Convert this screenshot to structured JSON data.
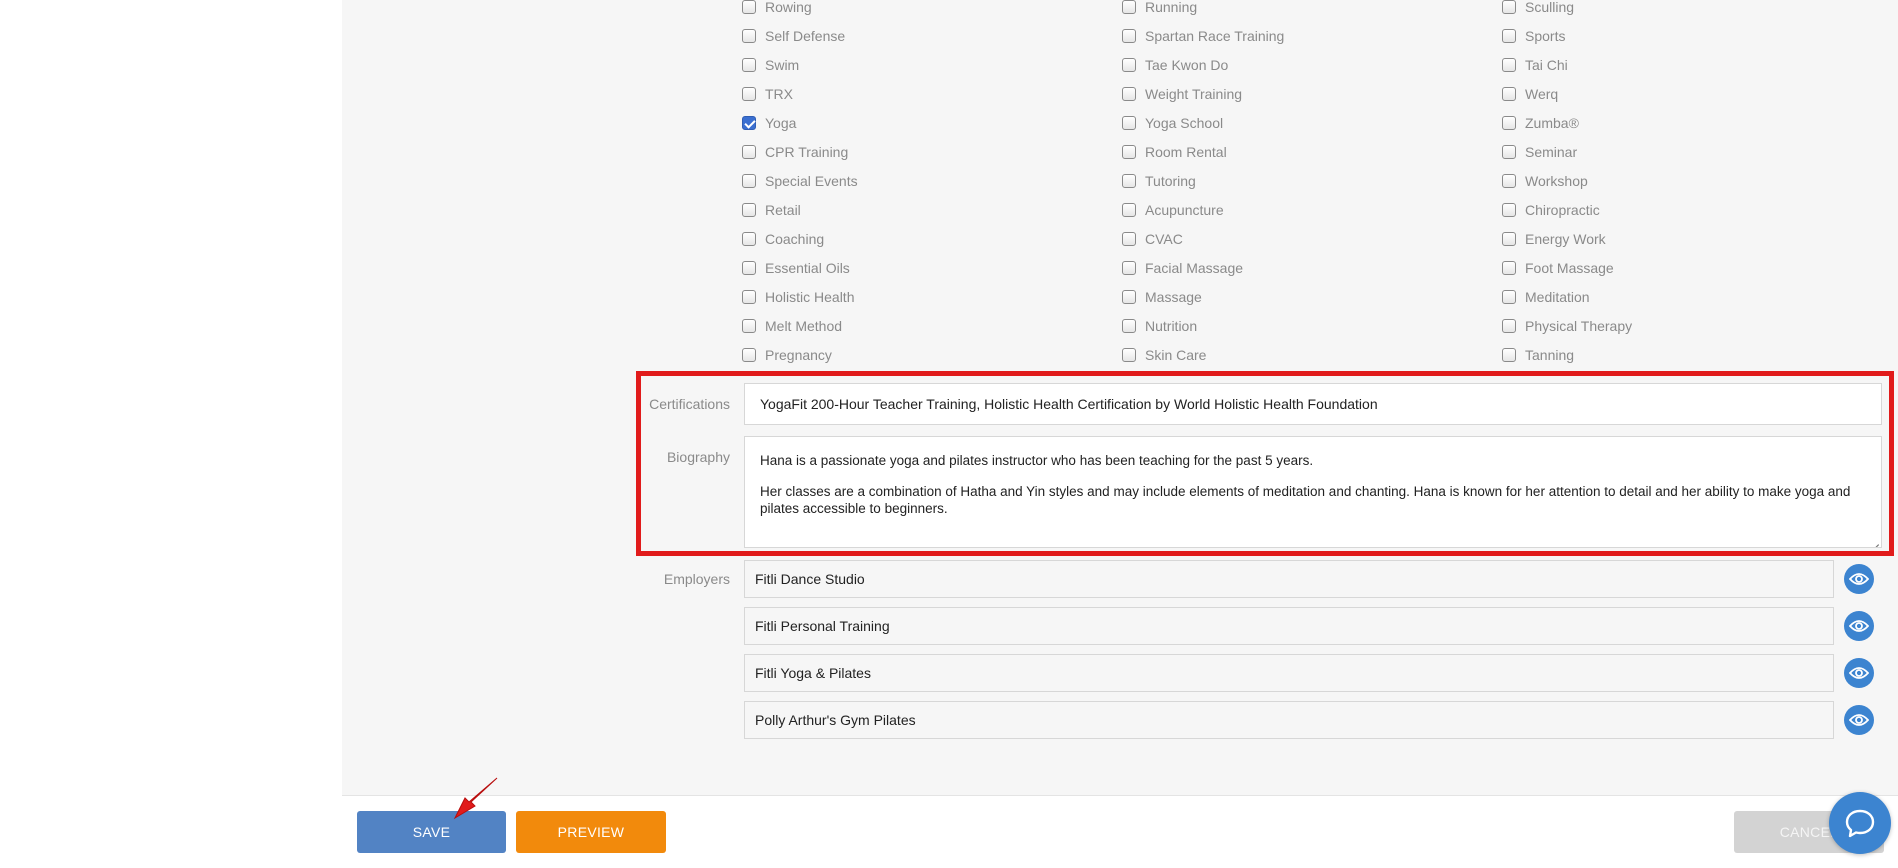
{
  "activities": {
    "columns": [
      [
        {
          "label": "Rowing",
          "checked": false
        },
        {
          "label": "Self Defense",
          "checked": false
        },
        {
          "label": "Swim",
          "checked": false
        },
        {
          "label": "TRX",
          "checked": false
        },
        {
          "label": "Yoga",
          "checked": true
        },
        {
          "label": "CPR Training",
          "checked": false
        },
        {
          "label": "Special Events",
          "checked": false
        },
        {
          "label": "Retail",
          "checked": false
        },
        {
          "label": "Coaching",
          "checked": false
        },
        {
          "label": "Essential Oils",
          "checked": false
        },
        {
          "label": "Holistic Health",
          "checked": false
        },
        {
          "label": "Melt Method",
          "checked": false
        },
        {
          "label": "Pregnancy",
          "checked": false
        }
      ],
      [
        {
          "label": "Running",
          "checked": false
        },
        {
          "label": "Spartan Race Training",
          "checked": false
        },
        {
          "label": "Tae Kwon Do",
          "checked": false
        },
        {
          "label": "Weight Training",
          "checked": false
        },
        {
          "label": "Yoga School",
          "checked": false
        },
        {
          "label": "Room Rental",
          "checked": false
        },
        {
          "label": "Tutoring",
          "checked": false
        },
        {
          "label": "Acupuncture",
          "checked": false
        },
        {
          "label": "CVAC",
          "checked": false
        },
        {
          "label": "Facial Massage",
          "checked": false
        },
        {
          "label": "Massage",
          "checked": false
        },
        {
          "label": "Nutrition",
          "checked": false
        },
        {
          "label": "Skin Care",
          "checked": false
        }
      ],
      [
        {
          "label": "Sculling",
          "checked": false
        },
        {
          "label": "Sports",
          "checked": false
        },
        {
          "label": "Tai Chi",
          "checked": false
        },
        {
          "label": "Werq",
          "checked": false
        },
        {
          "label": "Zumba®",
          "checked": false
        },
        {
          "label": "Seminar",
          "checked": false
        },
        {
          "label": "Workshop",
          "checked": false
        },
        {
          "label": "Chiropractic",
          "checked": false
        },
        {
          "label": "Energy Work",
          "checked": false
        },
        {
          "label": "Foot Massage",
          "checked": false
        },
        {
          "label": "Meditation",
          "checked": false
        },
        {
          "label": "Physical Therapy",
          "checked": false
        },
        {
          "label": "Tanning",
          "checked": false
        }
      ]
    ]
  },
  "form": {
    "certifications_label": "Certifications",
    "certifications_value": "YogaFit 200-Hour Teacher Training, Holistic Health Certification by World Holistic Health Foundation",
    "biography_label": "Biography",
    "biography_p1": "Hana is a passionate yoga and pilates instructor who has been teaching for the past 5 years.",
    "biography_p2": "Her classes are a combination of Hatha and Yin styles and may include elements of meditation and chanting. Hana is known for her attention to detail and her ability to make yoga and pilates accessible to beginners.",
    "employers_label": "Employers",
    "employers": [
      "Fitli Dance Studio",
      "Fitli Personal Training",
      "Fitli Yoga & Pilates",
      "Polly Arthur's Gym Pilates"
    ]
  },
  "footer": {
    "save_label": "SAVE",
    "preview_label": "PREVIEW",
    "cancel_label": "CANCEL"
  },
  "colors": {
    "save": "#5283c4",
    "preview": "#f28a0c",
    "cancel": "#d3d3d3",
    "accent_eye": "#3c84d0",
    "highlight": "#e11b1b"
  },
  "icons": {
    "employer_view": "eye-icon",
    "chat": "chat-bubble-icon",
    "annotation": "red-arrow-icon"
  }
}
